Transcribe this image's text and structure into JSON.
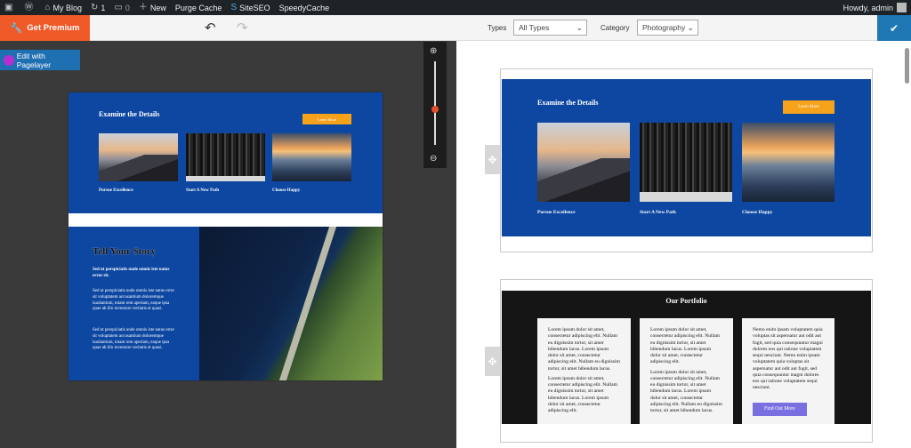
{
  "admin_bar": {
    "blog_name": "My Blog",
    "updates_count": "1",
    "comments_count": "0",
    "new_label": "New",
    "purge_cache_label": "Purge Cache",
    "siteseo_label": "SiteSEO",
    "speedycache_label": "SpeedyCache",
    "howdy_label": "Howdy, admin"
  },
  "toolbar": {
    "get_premium_label": "Get Premium",
    "types_label": "Types",
    "types_value": "All Types",
    "category_label": "Category",
    "category_value": "Photography"
  },
  "left_pane": {
    "edit_button_label": "Edit with Pagelayer",
    "preview": {
      "header_title": "Examine the Details",
      "learn_more_label": "Learn More",
      "captions": [
        "Pursue Excellence",
        "Start A New Path",
        "Choose Happy"
      ],
      "story_title": "Tell Your Story",
      "story_lead": "Sed ut perspiciatis unde omnis iste natus error sit.",
      "story_para_1": "Sed ut perspiciatis unde omnis iste natus error sit voluptatem accusantium doloremque laudantium, totam rem aperiam, eaque ipsa quae ab illo inventore veritatis et quasi.",
      "story_para_2": "Sed ut perspiciatis unde omnis iste natus error sit voluptatem accusantium doloremque laudantium, totam rem aperiam, eaque ipsa quae ab illo inventore veritatis et quasi."
    }
  },
  "right_pane": {
    "template_1": {
      "title": "Examine the Details",
      "learn_more_label": "Learn More",
      "captions": [
        "Pursue Excellence",
        "Start A New Path",
        "Choose Happy"
      ]
    },
    "template_2": {
      "title": "Our Portfolio",
      "col_1_p1": "Lorem ipsum dolor sit amet, consectetur adipiscing elit. Nullam eu dignissim tortor, sit amet bibendum lacus. Lorem ipsum dolor sit amet, consectetur adipiscing elit. Nullam eu dignissim tortor, sit amet bibendum lacus.",
      "col_1_p2": "Lorem ipsum dolor sit amet, consectetur adipiscing elit. Nullam eu dignissim tortor, sit amet bibendum lacus. Lorem ipsum dolor sit amet, consectetur adipiscing elit.",
      "col_2_p1": "Lorem ipsum dolor sit amet, consectetur adipiscing elit. Nullam eu dignissim tortor, sit amet bibendum lacus. Lorem ipsum dolor sit amet, consectetur adipiscing elit.",
      "col_2_p2": "Lorem ipsum dolor sit amet, consectetur adipiscing elit. Nullam eu dignissim tortor, sit amet bibendum lacus. Lorem ipsum dolor sit amet, consectetur adipiscing elit. Nullam eu dignissim tortor, sit amet bibendum lacus.",
      "col_3_p1": "Nemo enim ipsam voluptatem quia voluptas sit aspernatur aut odit aut fugit, sed quia consequuntur magni dolores eos qui ratione voluptatem sequi nesciunt. Nemo enim ipsam voluptatem quia voluptas sit aspernatur aut odit aut fugit, sed quia consequuntur magni dolores eos qui ratione voluptatem sequi nesciunt.",
      "find_out_label": "Find Out More"
    }
  },
  "colors": {
    "admin_bar": "#1d2327",
    "premium": "#f05a28",
    "confirm": "#1f78b4",
    "section_blue": "#0d47a1",
    "learn_more": "#f6a21b",
    "find_out": "#7a6fe0"
  },
  "icons": [
    "wordpress-icon",
    "home-icon",
    "refresh-icon",
    "comment-icon",
    "plus-icon",
    "siteseo-icon",
    "wrench-icon",
    "undo-icon",
    "redo-icon",
    "zoom-in-icon",
    "zoom-out-icon",
    "check-icon",
    "move-icon"
  ]
}
